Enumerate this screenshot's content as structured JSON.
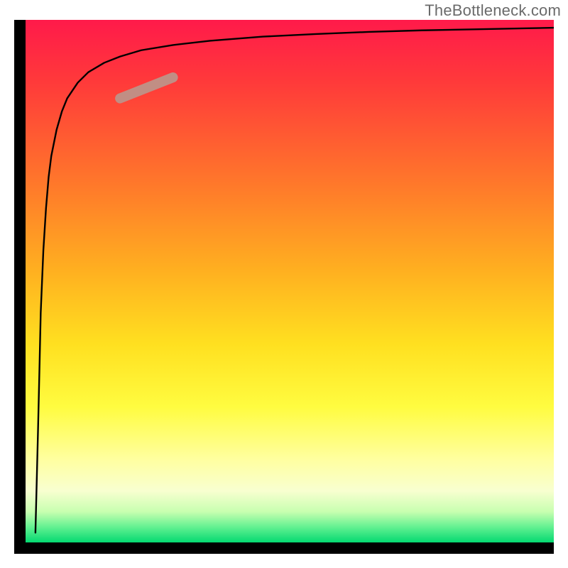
{
  "watermark": "TheBottleneck.com",
  "colors": {
    "axis": "#000000",
    "curve": "#000000",
    "highlight": "#c18e84",
    "watermark_text": "#6a6a6a"
  },
  "chart_data": {
    "type": "line",
    "title": "",
    "xlabel": "",
    "ylabel": "",
    "xlim": [
      0,
      100
    ],
    "ylim": [
      0,
      100
    ],
    "x": [
      2,
      2.2,
      2.5,
      2.8,
      3,
      3.5,
      4,
      4.5,
      5,
      6,
      7,
      8,
      10,
      12,
      15,
      18,
      22,
      28,
      35,
      45,
      55,
      65,
      75,
      85,
      95,
      100
    ],
    "values": [
      2,
      10,
      22,
      35,
      44,
      56,
      64,
      70,
      74,
      79,
      82.5,
      85,
      88,
      90,
      91.8,
      93,
      94.2,
      95.2,
      96,
      96.8,
      97.3,
      97.7,
      98,
      98.2,
      98.4,
      98.5
    ],
    "highlight_segment": {
      "x_start": 18,
      "x_end": 28,
      "y_start": 85,
      "y_end": 89
    },
    "grid": false,
    "legend": false,
    "background_gradient": {
      "direction": "vertical",
      "stops": [
        {
          "pos": 0.0,
          "color": "#ff1a4a"
        },
        {
          "pos": 0.12,
          "color": "#ff3a3a"
        },
        {
          "pos": 0.32,
          "color": "#ff7a2a"
        },
        {
          "pos": 0.48,
          "color": "#ffb020"
        },
        {
          "pos": 0.62,
          "color": "#ffe020"
        },
        {
          "pos": 0.74,
          "color": "#fffc40"
        },
        {
          "pos": 0.84,
          "color": "#ffffa0"
        },
        {
          "pos": 0.9,
          "color": "#f8ffd0"
        },
        {
          "pos": 0.94,
          "color": "#c8ffb0"
        },
        {
          "pos": 0.97,
          "color": "#60f090"
        },
        {
          "pos": 1.0,
          "color": "#00d870"
        }
      ]
    }
  }
}
